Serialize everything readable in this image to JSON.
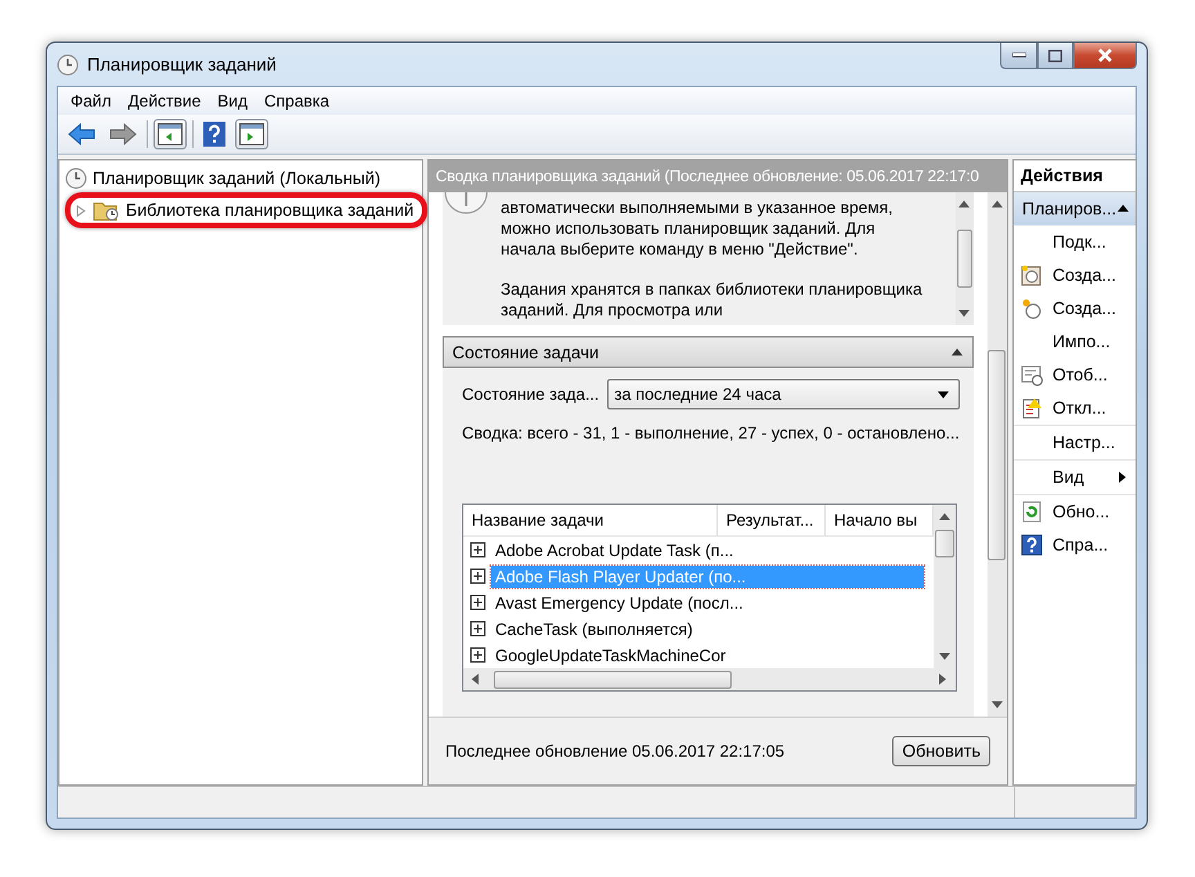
{
  "window": {
    "title": "Планировщик заданий"
  },
  "menu": [
    {
      "label": "Файл"
    },
    {
      "label": "Действие"
    },
    {
      "label": "Вид"
    },
    {
      "label": "Справка"
    }
  ],
  "tree": [
    {
      "label": "Планировщик заданий (Локальный)",
      "selected": false,
      "children": [
        {
          "label": "Библиотека планировщика заданий",
          "expanded": false,
          "highlighted": true,
          "selected": false
        }
      ]
    }
  ],
  "summary": {
    "header": "Сводка планировщика заданий (Последнее обновление: 05.06.2017 22:17:0",
    "description": [
      "автоматически выполняемыми в указанное время, можно использовать планировщик заданий. Для начала выберите команду в меню \"Действие\".",
      "Задания хранятся в папках библиотеки планировщика заданий. Для просмотра или"
    ],
    "section": {
      "title": "Состояние задачи",
      "expanded": true,
      "filter_label": "Состояние зада...",
      "filter_value": "за последние 24 часа",
      "totals": "Сводка: всего - 31, 1 - выполнение, 27 - успех, 0 - остановлено...",
      "table": {
        "columns": [
          "Название задачи",
          "Результат...",
          "Начало вы"
        ],
        "rows": [
          {
            "name": "Adobe Acrobat Update Task (п...",
            "selected": false
          },
          {
            "name": "Adobe Flash Player Updater (по...",
            "selected": true
          },
          {
            "name": "Avast Emergency Update (посл...",
            "selected": false
          },
          {
            "name": "CacheTask (выполняется)",
            "selected": false
          },
          {
            "name": "GoogleUpdateTaskMachineCor",
            "selected": false
          }
        ]
      }
    },
    "footer": "Последнее обновление 05.06.2017 22:17:05",
    "refresh_button": "Обновить"
  },
  "actions": {
    "title": "Действия",
    "group": {
      "label": "Планиров...",
      "expanded": true
    },
    "sections": [
      [
        {
          "label": "Подк...",
          "kind": "command"
        },
        {
          "label": "Созда...",
          "kind": "command"
        },
        {
          "label": "Созда...",
          "kind": "command"
        },
        {
          "label": "Импо...",
          "kind": "command"
        },
        {
          "label": "Отоб...",
          "kind": "command"
        },
        {
          "label": "Откл...",
          "kind": "command"
        }
      ],
      [
        {
          "label": "Настр...",
          "kind": "command"
        }
      ],
      [
        {
          "label": "Вид",
          "kind": "submenu"
        }
      ],
      [
        {
          "label": "Обно...",
          "kind": "command"
        },
        {
          "label": "Спра...",
          "kind": "command"
        }
      ]
    ]
  }
}
